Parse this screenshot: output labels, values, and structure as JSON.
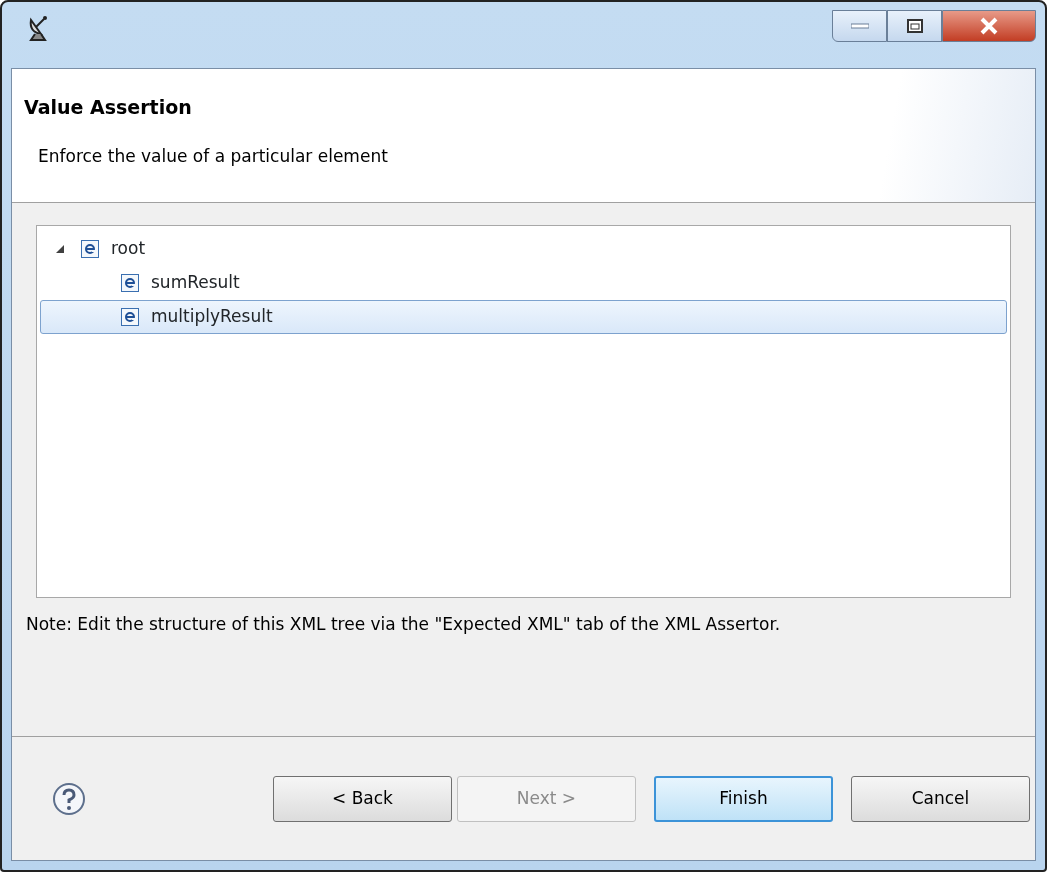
{
  "header": {
    "title": "Value Assertion",
    "description": "Enforce the value of a particular element"
  },
  "tree": [
    {
      "label": "root",
      "expanded": true,
      "selected": false,
      "children": [
        {
          "label": "sumResult",
          "selected": false
        },
        {
          "label": "multiplyResult",
          "selected": true
        }
      ]
    }
  ],
  "note": "Note: Edit the structure of this XML tree via the \"Expected XML\" tab of the XML Assertor.",
  "buttons": [
    {
      "label": "< Back",
      "disabled": false,
      "default": false
    },
    {
      "label": "Next >",
      "disabled": true,
      "default": false
    },
    {
      "label": "Finish",
      "disabled": false,
      "default": true
    },
    {
      "label": "Cancel",
      "disabled": false,
      "default": false
    }
  ]
}
